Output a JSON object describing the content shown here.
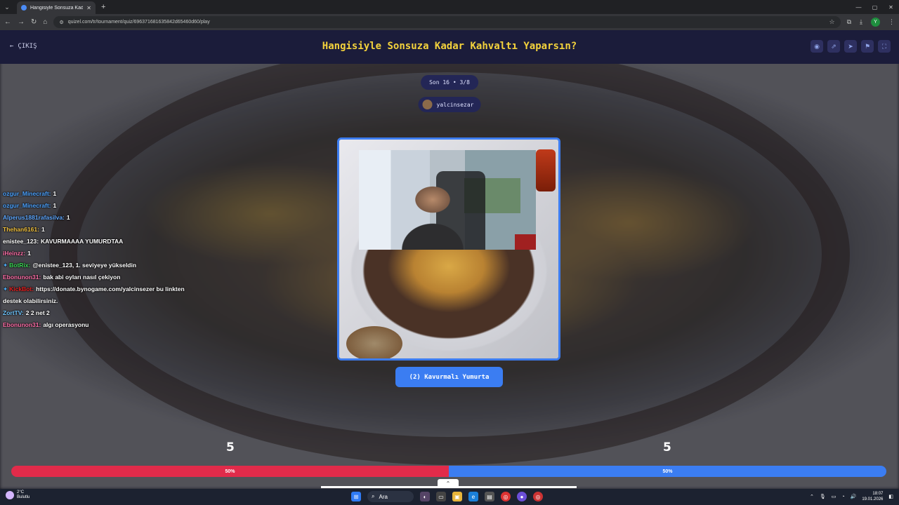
{
  "browser": {
    "tab_title": "Hangisiyle Sonsuza Kadar Kahv...",
    "url": "quizel.com/tr/tournament/quiz/696371681635842d65460d60/play",
    "profile_initial": "Y"
  },
  "header": {
    "exit_label": "ÇIKIŞ",
    "title": "Hangisiyle Sonsuza Kadar Kahvaltı Yaparsın?"
  },
  "round": {
    "label": "Son 16 • 3/8"
  },
  "user": {
    "name": "yalcinsezar"
  },
  "choice": {
    "label": "(2) Kavurmalı Yumurta"
  },
  "chat": [
    {
      "user": "ozgur_Minecraft:",
      "text": "1",
      "color": "#4da3ff",
      "badges": false
    },
    {
      "user": "ozgur_Minecraft:",
      "text": "1",
      "color": "#4da3ff",
      "badges": false
    },
    {
      "user": "Alperus1881rafasilva:",
      "text": "1",
      "color": "#5fa8ff",
      "badges": false
    },
    {
      "user": "Thehan6161:",
      "text": "1",
      "color": "#f0c040",
      "badges": false
    },
    {
      "user": "enistee_123:",
      "text": "KAVURMAAAA YUMURDTAA",
      "color": "#ffffff",
      "badges": false
    },
    {
      "user": "iHeinzz:",
      "text": "1",
      "color": "#ff6fa8",
      "badges": false
    },
    {
      "user": "BotRix:",
      "text": "@enistee_123, 1. seviyeye yükseldin",
      "color": "#39d353",
      "badges": true
    },
    {
      "user": "Ebonunon31:",
      "text": "bak abi oyları nasıl çekiyon",
      "color": "#ff6fa8",
      "badges": false
    },
    {
      "user": "KickBot:",
      "text": "https://donate.bynogame.com/yalcinsezer bu linkten destek olabilirsiniz.",
      "color": "#e82020",
      "badges": true
    },
    {
      "user": "ZortTV:",
      "text": "2 2 net 2",
      "color": "#6ec6ff",
      "badges": false
    },
    {
      "user": "Ebonunon31:",
      "text": "algı operasyonu",
      "color": "#ff6fa8",
      "badges": false
    }
  ],
  "scores": {
    "left": "5",
    "right": "5",
    "left_pct": "50%",
    "right_pct": "50%",
    "left_fraction": 0.5,
    "left_color": "#e12b4a",
    "right_color": "#3b7df2"
  },
  "taskbar": {
    "weather_temp": "2°C",
    "weather_desc": "Bulutlu",
    "search_label": "Ara",
    "time": "18:07",
    "date": "19.01.2026"
  }
}
